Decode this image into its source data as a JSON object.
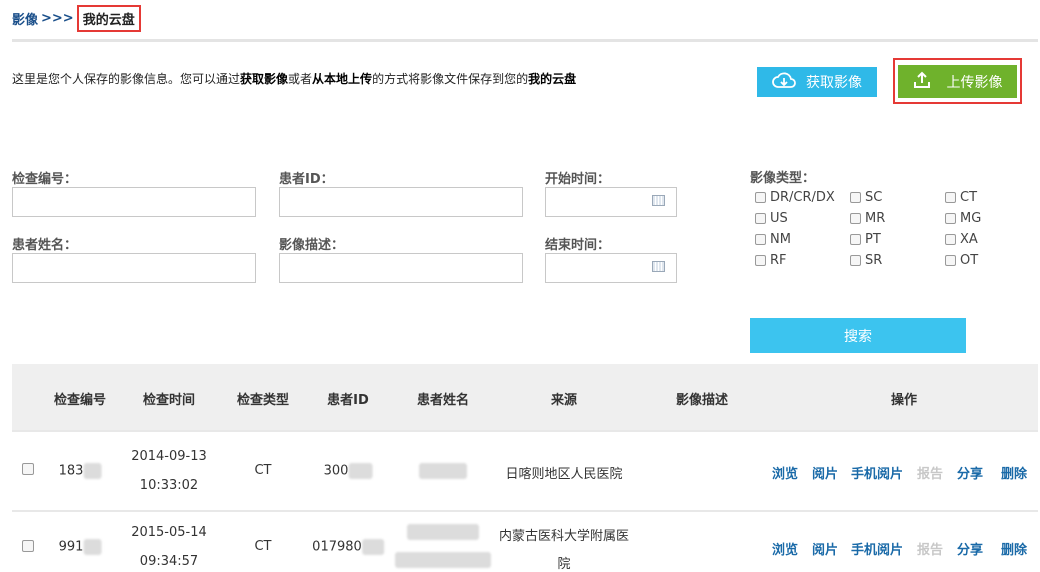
{
  "breadcrumb": {
    "parent": "影像",
    "sep": ">>>",
    "current": "我的云盘"
  },
  "intro": {
    "p1": "这里是您个人保存的影像信息。您可以通过",
    "b1": "获取影像",
    "p2": "或者",
    "b2": "从本地上传",
    "p3": "的方式将影像文件保存到您的",
    "b3": "我的云盘"
  },
  "buttons": {
    "fetch": "获取影像",
    "upload": "上传影像",
    "search": "搜索"
  },
  "form": {
    "exam_no_label": "检查编号：",
    "patient_id_label": "患者ID：",
    "start_time_label": "开始时间：",
    "patient_name_label": "患者姓名：",
    "image_desc_label": "影像描述：",
    "end_time_label": "结束时间：",
    "image_type_label": "影像类型：",
    "types": [
      "DR/CR/DX",
      "SC",
      "CT",
      "US",
      "MR",
      "MG",
      "NM",
      "PT",
      "XA",
      "RF",
      "SR",
      "OT"
    ]
  },
  "table": {
    "headers": [
      "检查编号",
      "检查时间",
      "检查类型",
      "患者ID",
      "患者姓名",
      "来源",
      "影像描述",
      "操作"
    ],
    "rows": [
      {
        "exam_no": "183",
        "date": "2014-09-13",
        "time": "10:33:02",
        "type": "CT",
        "patient_id": "300",
        "source_1": "日喀则地区人民医院",
        "source_2": ""
      },
      {
        "exam_no": "991",
        "date": "2015-05-14",
        "time": "09:34:57",
        "type": "CT",
        "patient_id": "017980",
        "source_1": "内蒙古医科大学附属医",
        "source_2": "院"
      }
    ],
    "actions": [
      "浏览",
      "阅片",
      "手机阅片",
      "报告",
      "分享",
      "删除"
    ]
  },
  "icons": {
    "fetch": "cloud-download-icon",
    "upload": "upload-arrow-icon",
    "calendar": "calendar-icon"
  },
  "colors": {
    "fetch_btn": "#2fb9e8",
    "upload_btn": "#6fb22c",
    "search_btn": "#3cc4ef",
    "highlight": "#e53935",
    "link": "#1a6aa8"
  }
}
